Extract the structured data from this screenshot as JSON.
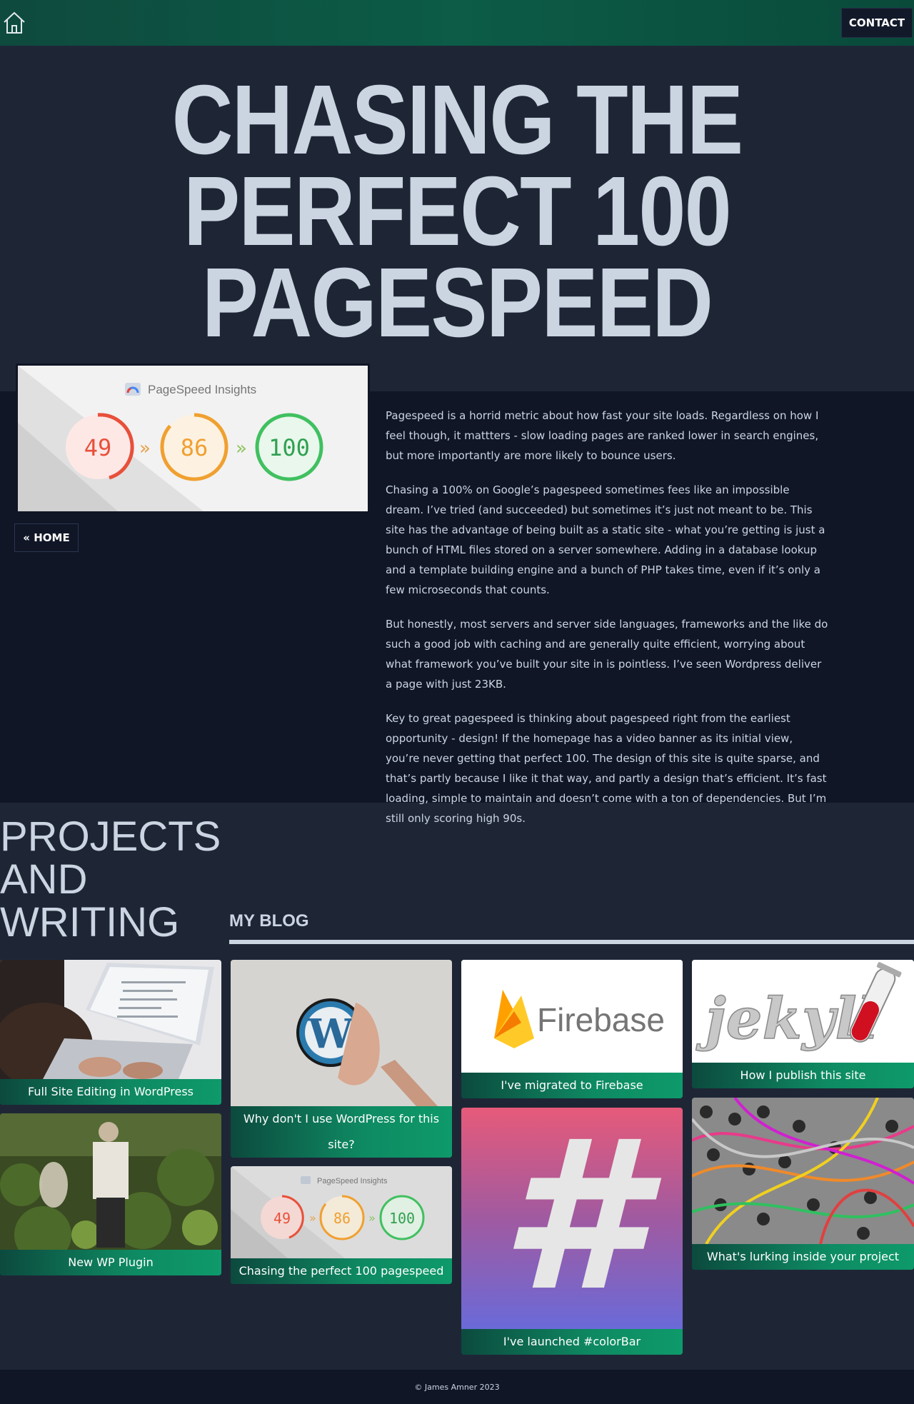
{
  "header": {
    "contact_label": "CONTACT"
  },
  "hero": {
    "title_line1": "CHASING THE",
    "title_line2": "PERFECT 100",
    "title_line3": "PAGESPEED"
  },
  "feature_image": {
    "brand": "PageSpeed Insights",
    "score1": "49",
    "score2": "86",
    "score3": "100",
    "arrow": "»"
  },
  "nav": {
    "back_home": "« HOME"
  },
  "article": {
    "paragraphs": [
      "Pagespeed is a horrid metric about how fast your site loads. Regardless on how I feel though, it mattters - slow loading pages are ranked lower in search engines, but more importantly are more likely to bounce users.",
      "Chasing a 100% on Google’s pagespeed sometimes fees like an impossible dream. I’ve tried (and succeeded) but sometimes it’s just not meant to be. This site has the advantage of being built as a static site - what you’re getting is just a bunch of HTML files stored on a server somewhere. Adding in a database lookup and a template building engine and a bunch of PHP takes time, even if it’s only a few microseconds that counts.",
      "But honestly, most servers and server side languages, frameworks and the like do such a good job with caching and are generally quite efficient, worrying about what framework you’ve built your site in is pointless. I’ve seen Wordpress deliver a page with just 23KB.",
      "Key to great pagespeed is thinking about pagespeed right from the earliest opportunity - design! If the homepage has a video banner as its initial view, you’re never getting that perfect 100. The design of this site is quite sparse, and that’s partly because I like it that way, and partly a design that’s efficient. It’s fast loading, simple to maintain and doesn’t come with a ton of dependencies. But I’m still only scoring high 90s."
    ]
  },
  "projects": {
    "title_line1": "PROJECTS",
    "title_line2": "AND",
    "title_line3": "WRITING"
  },
  "blog": {
    "title": "MY BLOG",
    "cards": [
      {
        "caption": "Full Site Editing in WordPress"
      },
      {
        "caption": "New WP Plugin"
      },
      {
        "caption": "Why don't I use WordPress for this site?"
      },
      {
        "caption": "Chasing the perfect 100 pagespeed"
      },
      {
        "caption": "I've migrated to Firebase",
        "logo_text": "Firebase"
      },
      {
        "caption": "I've launched #colorBar",
        "logo_text": "#"
      },
      {
        "caption": "How I publish this site",
        "logo_text": "jekyll"
      },
      {
        "caption": "What's lurking inside your project"
      }
    ]
  },
  "footer": {
    "copyright": "© James Amner 2023"
  },
  "colors": {
    "header_green": "#0c5c47",
    "background": "#1e2636",
    "article_bg": "#101626",
    "text": "#cbd5e1",
    "caption_green": "#0e8a62"
  }
}
